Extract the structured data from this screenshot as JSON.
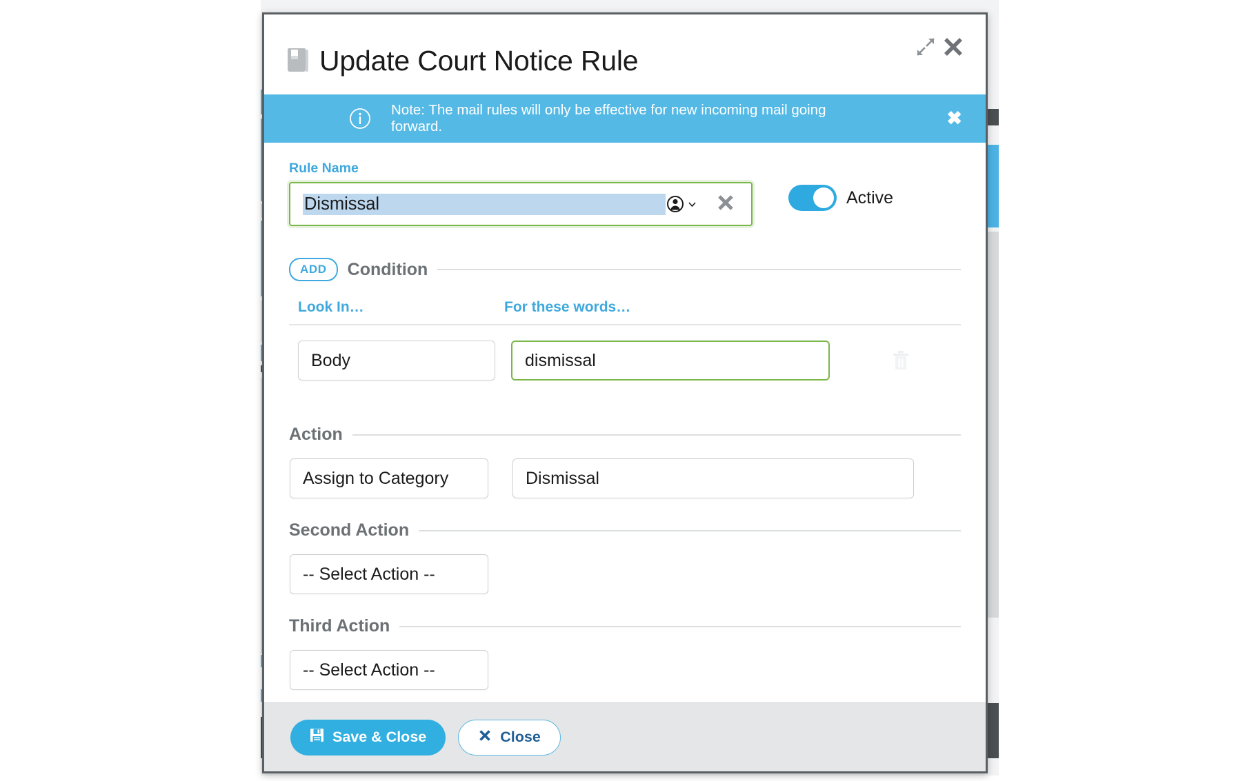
{
  "window": {
    "title": "Update Court Notice Rule",
    "title_icon": "book-icon",
    "expand_icon": "expand-arrows-icon",
    "close_icon": "close-icon"
  },
  "notice": {
    "icon": "info-circle-icon",
    "text": "Note: The mail rules will only be effective for new incoming mail going forward.",
    "close_label": "✖"
  },
  "rule_name": {
    "label": "Rule Name",
    "value": "Dismissal",
    "placeholder": "Rule Name",
    "picker_icon": "person-circle-icon",
    "picker_chevron": "chevron-down-icon",
    "clear_icon": "clear-x-icon"
  },
  "active_toggle": {
    "label": "Active",
    "state": "on"
  },
  "condition": {
    "add_label": "ADD",
    "section_title": "Condition",
    "columns": [
      "Look In…",
      "For these words…"
    ],
    "rows": [
      {
        "look_in": "Body",
        "words": "dismissal",
        "delete_icon": "trash-icon"
      }
    ]
  },
  "action": {
    "section_title": "Action",
    "select_value": "Assign to Category",
    "value": "Dismissal"
  },
  "second_action": {
    "section_title": "Second Action",
    "select_value": "-- Select Action --"
  },
  "third_action": {
    "section_title": "Third Action",
    "select_value": "-- Select Action --"
  },
  "footer": {
    "save_label": "Save & Close",
    "save_icon": "save-disk-icon",
    "close_label": "Close",
    "close_icon": "close-x-icon"
  },
  "colors": {
    "accent_blue": "#31afe0",
    "notice_blue": "#55b9e6",
    "label_blue": "#3fa9dd",
    "focus_green": "#7ab648",
    "section_gray": "#6b7175",
    "footer_gray": "#e4e6e7",
    "selection_highlight": "#bdd7ee"
  }
}
